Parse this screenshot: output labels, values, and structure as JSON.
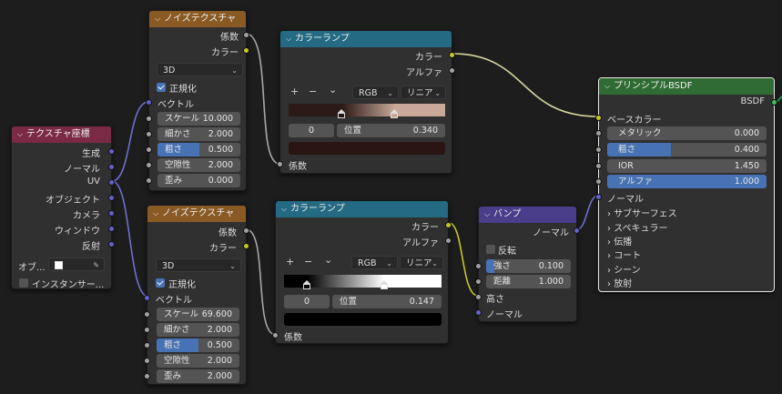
{
  "texcoord": {
    "title": "テクスチャ座標",
    "outputs": [
      "生成",
      "ノーマル",
      "UV",
      "オブジェクト",
      "カメラ",
      "ウィンドウ",
      "反射"
    ],
    "object_label": "オブ...",
    "instancer_label": "インスタンサー..."
  },
  "noise1": {
    "title": "ノイズテクスチャ",
    "out_fac": "係数",
    "out_color": "カラー",
    "dimensions": "3D",
    "normalize_label": "正規化",
    "vector_label": "ベクトル",
    "fields": [
      {
        "label": "スケール",
        "value": "10.000"
      },
      {
        "label": "細かさ",
        "value": "2.000"
      },
      {
        "label": "粗さ",
        "value": "0.500"
      },
      {
        "label": "空隙性",
        "value": "2.000"
      },
      {
        "label": "歪み",
        "value": "0.000"
      }
    ]
  },
  "noise2": {
    "title": "ノイズテクスチャ",
    "out_fac": "係数",
    "out_color": "カラー",
    "dimensions": "3D",
    "normalize_label": "正規化",
    "vector_label": "ベクトル",
    "fields": [
      {
        "label": "スケール",
        "value": "69.600"
      },
      {
        "label": "細かさ",
        "value": "2.000"
      },
      {
        "label": "粗さ",
        "value": "0.500"
      },
      {
        "label": "空隙性",
        "value": "2.000"
      },
      {
        "label": "歪み",
        "value": "2.000"
      }
    ]
  },
  "ramp1": {
    "title": "カラーランプ",
    "out_color": "カラー",
    "out_alpha": "アルファ",
    "plus": "+",
    "minus": "−",
    "chevron": "⌄",
    "color_mode": "RGB",
    "interp": "リニア",
    "index": "0",
    "pos_label": "位置",
    "pos_value": "0.340",
    "in_fac": "係数",
    "colors": {
      "left": "#2b1a15",
      "right": "#c8a898",
      "swatch": "#2a1512"
    }
  },
  "ramp2": {
    "title": "カラーランプ",
    "out_color": "カラー",
    "out_alpha": "アルファ",
    "plus": "+",
    "minus": "−",
    "chevron": "⌄",
    "color_mode": "RGB",
    "interp": "リニア",
    "index": "0",
    "pos_label": "位置",
    "pos_value": "0.147",
    "in_fac": "係数",
    "colors": {
      "left": "#000000",
      "right": "#ffffff",
      "swatch": "#000000"
    }
  },
  "bump": {
    "title": "バンプ",
    "out_normal": "ノーマル",
    "invert_label": "反転",
    "fields": [
      {
        "label": "強さ",
        "value": "0.100"
      },
      {
        "label": "距離",
        "value": "1.000"
      }
    ],
    "in_height": "高さ",
    "in_normal": "ノーマル"
  },
  "bsdf": {
    "title": "プリンシプルBSDF",
    "out_bsdf": "BSDF",
    "base_color": "ベースカラー",
    "fields": [
      {
        "label": "メタリック",
        "value": "0.000"
      },
      {
        "label": "粗さ",
        "value": "0.400"
      },
      {
        "label": "IOR",
        "value": "1.450"
      },
      {
        "label": "アルファ",
        "value": "1.000"
      }
    ],
    "normal_label": "ノーマル",
    "panels": [
      "サブサーフェス",
      "スペキュラー",
      "伝播",
      "コート",
      "シーン",
      "放射"
    ]
  },
  "colors": {
    "header_texture": "#8a5a24",
    "header_converter": "#236a82",
    "header_vector": "#4a3d8a",
    "header_input": "#7a2a45",
    "header_shader": "#2f6b32",
    "socket_color": "#c7c729",
    "socket_float": "#a1a1a1",
    "socket_vector": "#6363c7",
    "slider_fill": "#4772b3"
  }
}
